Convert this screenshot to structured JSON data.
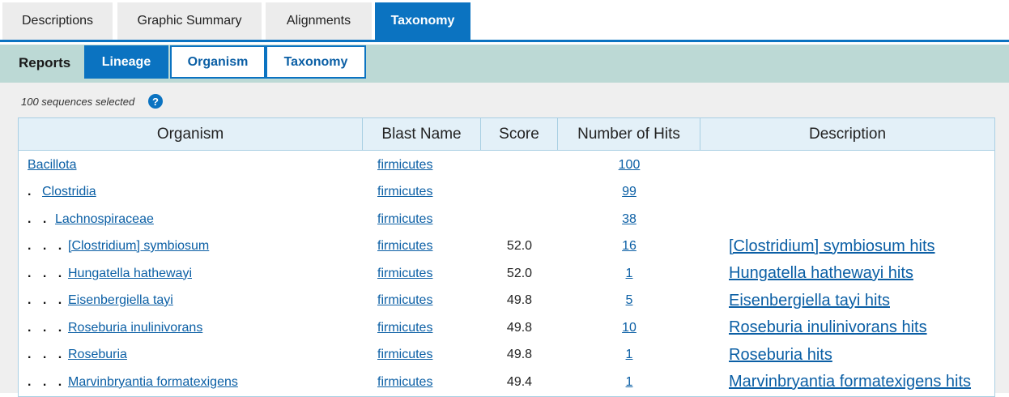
{
  "tabs": [
    {
      "label": "Descriptions",
      "active": false
    },
    {
      "label": "Graphic Summary",
      "active": false
    },
    {
      "label": "Alignments",
      "active": false
    },
    {
      "label": "Taxonomy",
      "active": true
    }
  ],
  "reports": {
    "label": "Reports",
    "subtabs": [
      {
        "label": "Lineage",
        "active": true
      },
      {
        "label": "Organism",
        "active": false
      },
      {
        "label": "Taxonomy",
        "active": false
      }
    ]
  },
  "selection": {
    "text": "100 sequences selected",
    "help_icon": "question-circle-icon"
  },
  "table": {
    "headers": [
      "Organism",
      "Blast Name",
      "Score",
      "Number of Hits",
      "Description"
    ],
    "rows": [
      {
        "dots": "",
        "organism": "Bacillota",
        "blast_name": "firmicutes",
        "score": "",
        "hits": "100",
        "description": ""
      },
      {
        "dots": ".",
        "organism": "Clostridia",
        "blast_name": "firmicutes",
        "score": "",
        "hits": "99",
        "description": ""
      },
      {
        "dots": ". .",
        "organism": "Lachnospiraceae",
        "blast_name": "firmicutes",
        "score": "",
        "hits": "38",
        "description": ""
      },
      {
        "dots": ". . .",
        "organism": "[Clostridium] symbiosum",
        "blast_name": "firmicutes",
        "score": "52.0",
        "hits": "16",
        "description": "[Clostridium] symbiosum hits"
      },
      {
        "dots": ". . .",
        "organism": "Hungatella hathewayi",
        "blast_name": "firmicutes",
        "score": "52.0",
        "hits": "1",
        "description": "Hungatella hathewayi hits"
      },
      {
        "dots": ". . .",
        "organism": "Eisenbergiella tayi",
        "blast_name": "firmicutes",
        "score": "49.8",
        "hits": "5",
        "description": "Eisenbergiella tayi hits"
      },
      {
        "dots": ". . .",
        "organism": "Roseburia inulinivorans",
        "blast_name": "firmicutes",
        "score": "49.8",
        "hits": "10",
        "description": "Roseburia inulinivorans hits"
      },
      {
        "dots": ". . .",
        "organism": "Roseburia",
        "blast_name": "firmicutes",
        "score": "49.8",
        "hits": "1",
        "description": "Roseburia hits"
      },
      {
        "dots": ". . .",
        "organism": "Marvinbryantia formatexigens",
        "blast_name": "firmicutes",
        "score": "49.4",
        "hits": "1",
        "description": "Marvinbryantia formatexigens hits"
      }
    ]
  },
  "colors": {
    "accent": "#0b73c1",
    "reports_bar": "#bcd9d5",
    "link": "#0b5fa5",
    "header_bg": "#e3f0f8"
  }
}
